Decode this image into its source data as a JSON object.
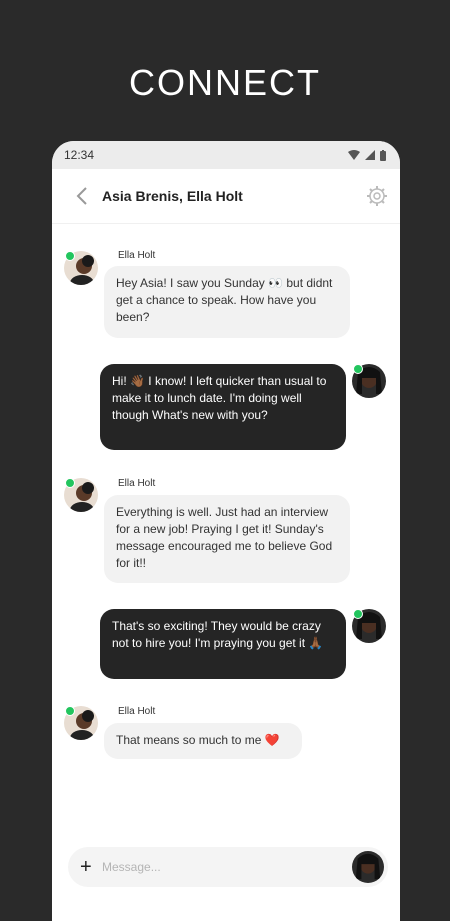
{
  "headline": "CONNECT",
  "status": {
    "time": "12:34"
  },
  "chat": {
    "title": "Asia Brenis, Ella Holt",
    "messages": [
      {
        "sender": "Ella Holt",
        "text": "Hey Asia! I saw you Sunday 👀 but didnt get a chance to speak. How have you been?",
        "direction": "incoming"
      },
      {
        "text": "Hi! 👋🏾 I know! I left quicker than usual to make it to lunch date. I'm doing well though What's new with you?",
        "direction": "outgoing"
      },
      {
        "sender": "Ella Holt",
        "text": "Everything is well. Just had an interview for a new job! Praying I get it! Sunday's message encouraged me to believe God for it!!",
        "direction": "incoming"
      },
      {
        "text": "That's so exciting! They would be crazy not to hire you! I'm praying you get it 🙏🏾",
        "direction": "outgoing"
      },
      {
        "sender": "Ella Holt",
        "text": "That means so much to me ❤️",
        "direction": "incoming"
      }
    ]
  },
  "composer": {
    "placeholder": "Message...",
    "add_symbol": "+"
  },
  "icons": {
    "back": "chevron-left-icon",
    "settings": "gear-icon",
    "wifi": "wifi-icon",
    "signal": "signal-icon",
    "battery": "battery-icon",
    "add": "plus-icon"
  },
  "colors": {
    "background": "#2a2a2a",
    "outgoing_bubble": "#252525",
    "incoming_bubble": "#f2f2f2",
    "online": "#22c55e"
  }
}
